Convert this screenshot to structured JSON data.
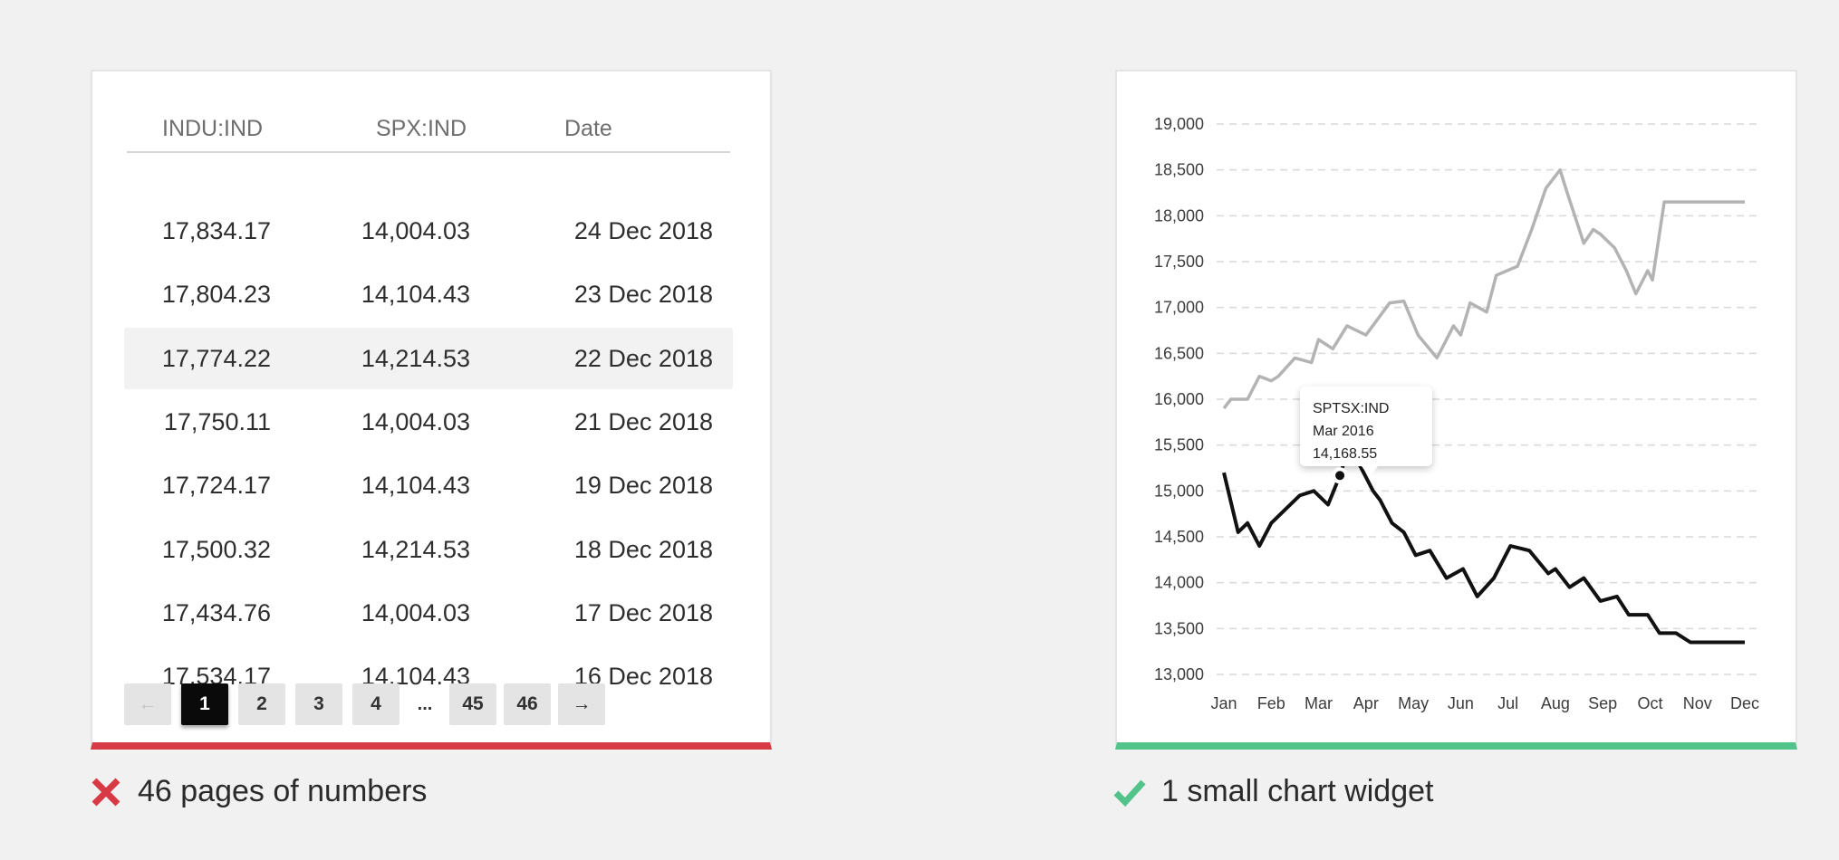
{
  "table": {
    "columns": [
      "INDU:IND",
      "SPX:IND",
      "Date"
    ],
    "rows": [
      [
        "17,834.17",
        "14,004.03",
        "24 Dec 2018"
      ],
      [
        "17,804.23",
        "14,104.43",
        "23 Dec 2018"
      ],
      [
        "17,774.22",
        "14,214.53",
        "22 Dec 2018"
      ],
      [
        "17,750.11",
        "14,004.03",
        "21 Dec 2018"
      ],
      [
        "17,724.17",
        "14,104.43",
        "19 Dec 2018"
      ],
      [
        "17,500.32",
        "14,214.53",
        "18 Dec 2018"
      ],
      [
        "17,434.76",
        "14,004.03",
        "17 Dec 2018"
      ],
      [
        "17,534.17",
        "14,104.43",
        "16 Dec 2018"
      ]
    ],
    "highlighted_row": 2
  },
  "pagination": {
    "prev": "←",
    "pages": [
      "1",
      "2",
      "3",
      "4"
    ],
    "ellipsis": "...",
    "last_pages": [
      "45",
      "46"
    ],
    "next": "→",
    "active": "1"
  },
  "captions": {
    "left": "46 pages of numbers",
    "right": "1 small chart widget",
    "left_icon": "cross-icon",
    "right_icon": "check-icon"
  },
  "colors": {
    "bad": "#d83a45",
    "good": "#52c48b",
    "series_gray": "#b3b3b3",
    "series_black": "#111111"
  },
  "chart_data": {
    "type": "line",
    "categories": [
      "Jan",
      "Feb",
      "Mar",
      "Apr",
      "May",
      "Jun",
      "Jul",
      "Aug",
      "Sep",
      "Oct",
      "Nov",
      "Dec"
    ],
    "ylim": [
      13000,
      19000
    ],
    "yticks": [
      "13,000",
      "13,500",
      "14,000",
      "14,500",
      "15,000",
      "15,500",
      "16,000",
      "16,500",
      "17,000",
      "17,500",
      "18,000",
      "18,500",
      "19,000"
    ],
    "grid": true,
    "series": [
      {
        "color": "gray",
        "x": [
          0,
          0.15,
          0.5,
          0.75,
          1.0,
          1.15,
          1.5,
          1.85,
          2.0,
          2.3,
          2.6,
          3.0,
          3.5,
          3.8,
          4.1,
          4.5,
          4.65,
          4.85,
          5.0,
          5.2,
          5.55,
          5.75,
          6.2,
          6.5,
          6.8,
          7.1,
          7.25,
          7.6,
          7.8,
          7.95,
          8.15,
          8.25,
          8.5,
          8.7,
          8.95,
          9.05,
          9.3,
          9.55,
          9.8,
          10.0,
          10.15,
          10.3,
          10.5,
          10.65,
          10.85,
          11.0
        ],
        "y": [
          15900,
          16000,
          16000,
          16250,
          16200,
          16250,
          16450,
          16400,
          16650,
          16550,
          16800,
          16700,
          17050,
          17070,
          16700,
          16450,
          16600,
          16800,
          16700,
          17050,
          16950,
          17350,
          17450,
          17850,
          18300,
          18500,
          18250,
          17700,
          17850,
          17800,
          17700,
          17650,
          17400,
          17150,
          17400,
          17300,
          18150,
          18150,
          18150,
          18150,
          18150,
          18150,
          18150,
          18150,
          18150,
          18150
        ]
      },
      {
        "name": "SPTSX:IND",
        "color": "black",
        "x": [
          0,
          0.3,
          0.5,
          0.75,
          1.0,
          1.3,
          1.6,
          1.9,
          2.2,
          2.45,
          2.65,
          2.9,
          3.15,
          3.3,
          3.55,
          3.8,
          4.05,
          4.35,
          4.7,
          5.05,
          5.35,
          5.7,
          6.05,
          6.45,
          6.85,
          7.0,
          7.3,
          7.6,
          7.95,
          8.3,
          8.55,
          8.95,
          9.2,
          9.55,
          9.85,
          10.2,
          10.45,
          10.8,
          11.0
        ],
        "y": [
          15200,
          14550,
          14650,
          14400,
          14650,
          14800,
          14950,
          15000,
          14850,
          15168.55,
          15500,
          15250,
          15000,
          14900,
          14650,
          14550,
          14300,
          14350,
          14050,
          14150,
          13850,
          14050,
          14400,
          14350,
          14100,
          14150,
          13950,
          14050,
          13800,
          13850,
          13650,
          13650,
          13450,
          13450,
          13350,
          13350,
          13350,
          13350,
          13350
        ]
      }
    ],
    "tooltip": {
      "series": "SPTSX:IND",
      "date": "Mar 2016",
      "value": "14,168.55"
    }
  }
}
